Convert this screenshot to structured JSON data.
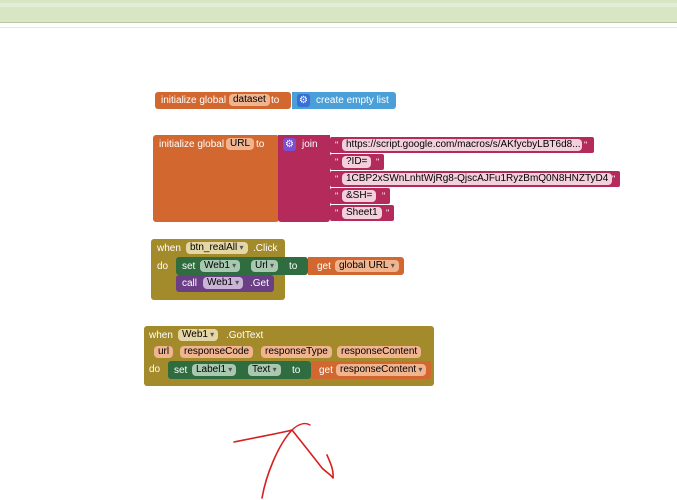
{
  "colors": {
    "variables": "#d2682f",
    "lists": "#4a9fd8",
    "text": "#b42b5b",
    "control": "#a38a2b",
    "component_set": "#2f6d40",
    "component_call": "#6b3f86",
    "annotation": "#d62020"
  },
  "init_dataset": {
    "prefix": "initialize global",
    "name": "dataset",
    "to": "to",
    "value": "create empty list"
  },
  "init_url": {
    "prefix": "initialize global",
    "name": "URL",
    "to": "to",
    "join": "join",
    "strings": [
      "https://script.google.com/macros/s/AKfycbyLBT6d8...",
      "?ID=",
      "1CBP2xSWnLnhtWjRg8-QjscAJFu1RyzBmQ0N8HNZTyD4",
      "&SH=",
      "Sheet1"
    ]
  },
  "click_event": {
    "when": "when",
    "component": "btn_realAll",
    "event": ".Click",
    "do": "do",
    "set": "set",
    "set_component": "Web1",
    "set_property": "Url",
    "to": "to",
    "get": "get",
    "get_var": "global URL",
    "call": "call",
    "call_component": "Web1",
    "call_method": ".Get"
  },
  "gettext_event": {
    "when": "when",
    "component": "Web1",
    "event": ".GotText",
    "params": [
      "url",
      "responseCode",
      "responseType",
      "responseContent"
    ],
    "do": "do",
    "set": "set",
    "set_component": "Label1",
    "set_property": "Text",
    "to": "to",
    "get": "get",
    "get_var": "responseContent"
  }
}
